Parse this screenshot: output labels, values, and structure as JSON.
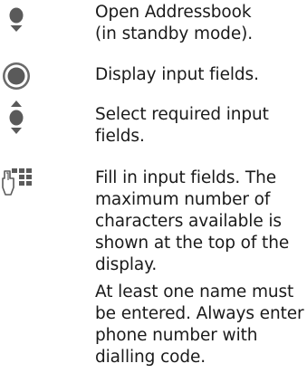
{
  "steps": [
    {
      "icon": "nav-key-down-icon",
      "lines": [
        "Open Addressbook",
        "(in standby mode)."
      ]
    },
    {
      "icon": "center-key-icon",
      "lines": [
        "Display input fields."
      ]
    },
    {
      "icon": "nav-key-up-down-icon",
      "lines": [
        "Select required input",
        "fields."
      ]
    },
    {
      "icon": "keypad-icon",
      "lines": [
        "Fill in input fields. The",
        "maximum number of",
        "characters available is",
        "shown at the top of the",
        "display."
      ]
    }
  ],
  "note": {
    "lines": [
      "At least one name must",
      "be entered. Always enter",
      "phone number with",
      "dialling code."
    ]
  },
  "colors": {
    "text": "#1a1a1a",
    "icon": "#5a5a5a"
  }
}
